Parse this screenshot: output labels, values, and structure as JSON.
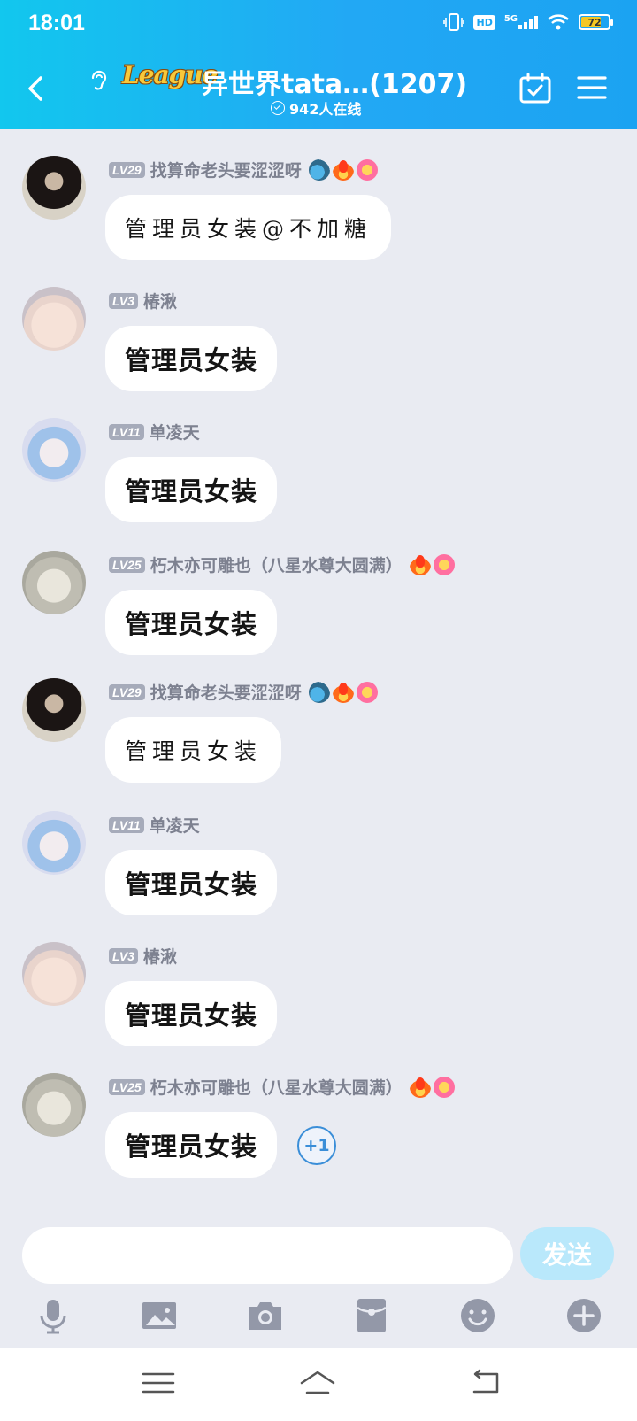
{
  "status_bar": {
    "time": "18:01",
    "network": "5G",
    "hd": "HD",
    "battery": "72"
  },
  "header": {
    "logo_text": "League",
    "title": "异世界tata…(1207)",
    "online_count": "942人在线"
  },
  "messages": [
    {
      "level": "LV29",
      "name": "找算命老头要涩涩呀",
      "text": "管理员女装@不加糖",
      "style": "hand",
      "badges": [
        "dragon",
        "fire",
        "flower"
      ]
    },
    {
      "level": "LV3",
      "name": "椿湫",
      "text": "管理员女装",
      "style": "normal",
      "badges": []
    },
    {
      "level": "LV11",
      "name": "单凌天",
      "text": "管理员女装",
      "style": "normal",
      "badges": []
    },
    {
      "level": "LV25",
      "name": "朽木亦可雕也（八星水尊大圆满）",
      "text": "管理员女装",
      "style": "normal",
      "badges": [
        "fire",
        "flower"
      ]
    },
    {
      "level": "LV29",
      "name": "找算命老头要涩涩呀",
      "text": "管理员女装",
      "style": "hand",
      "badges": [
        "dragon",
        "fire",
        "flower"
      ]
    },
    {
      "level": "LV11",
      "name": "单凌天",
      "text": "管理员女装",
      "style": "normal",
      "badges": []
    },
    {
      "level": "LV3",
      "name": "椿湫",
      "text": "管理员女装",
      "style": "normal",
      "badges": []
    },
    {
      "level": "LV25",
      "name": "朽木亦可雕也（八星水尊大圆满）",
      "text": "管理员女装",
      "style": "normal",
      "badges": [
        "fire",
        "flower"
      ]
    }
  ],
  "plus_one": "+1",
  "composer": {
    "input_value": "",
    "send_label": "发送"
  },
  "toolbar_icons": [
    "microphone-icon",
    "image-icon",
    "camera-icon",
    "red-packet-icon",
    "emoji-icon",
    "plus-icon"
  ],
  "colors": {
    "header_start": "#12c7ee",
    "header_end": "#1ba3f2",
    "background": "#e9ebf2",
    "send_button": "#b9e8fb",
    "level_badge": "#a6abba"
  }
}
